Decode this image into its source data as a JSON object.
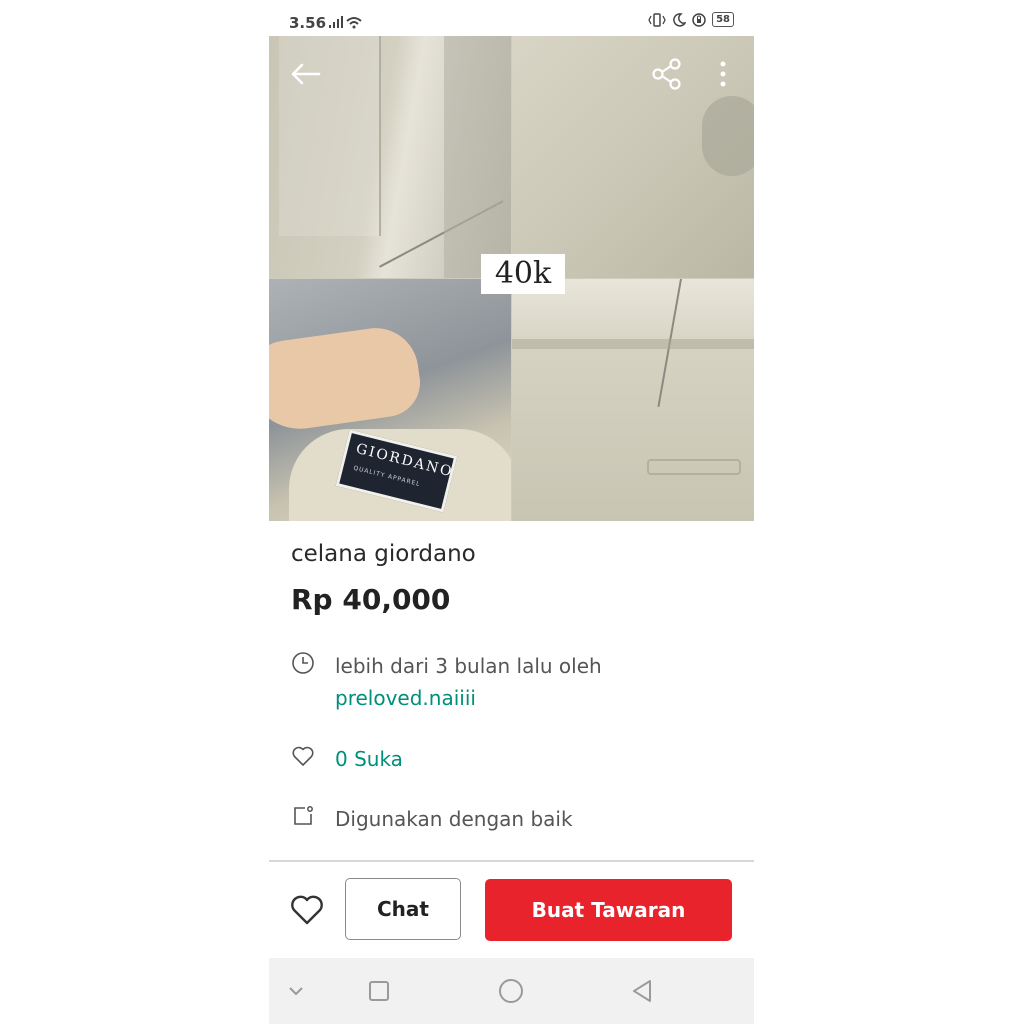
{
  "status_bar": {
    "time": "3.56",
    "battery": "58",
    "icons": [
      "signal-icon",
      "wifi-icon",
      "vibrate-icon",
      "moon-icon",
      "rotation-lock-icon",
      "battery-icon"
    ]
  },
  "hero": {
    "price_overlay": "40k",
    "label_brand": "GIORDANO",
    "label_sub": "QUALITY APPAREL",
    "icons": {
      "back": "back-arrow-icon",
      "share": "share-icon",
      "more": "more-vertical-icon"
    }
  },
  "listing": {
    "title": "celana giordano",
    "price": "Rp 40,000",
    "posted_text": "lebih dari 3 bulan lalu oleh",
    "seller": "preloved.naiiii",
    "likes": "0 Suka",
    "condition": "Digunakan dengan baik"
  },
  "actions": {
    "chat_label": "Chat",
    "offer_label": "Buat Tawaran"
  },
  "nav": {
    "icons": [
      "chevron-down-icon",
      "square-icon",
      "circle-icon",
      "triangle-back-icon"
    ]
  },
  "colors": {
    "accent": "#008f7a",
    "primary_button": "#e8232b"
  }
}
